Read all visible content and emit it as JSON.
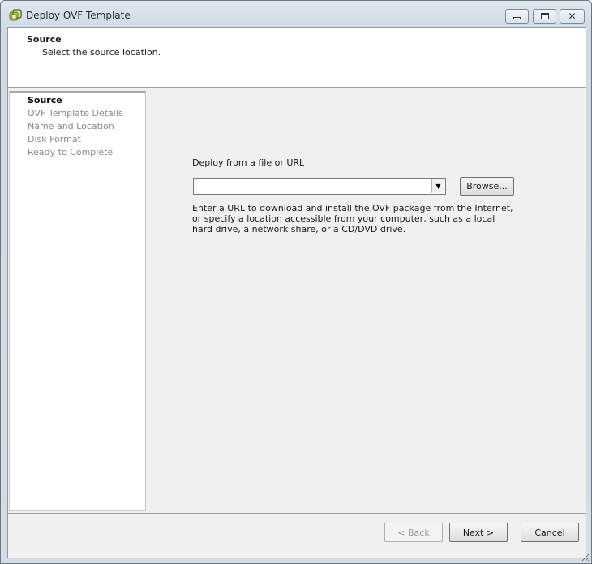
{
  "window": {
    "title": "Deploy OVF Template",
    "icon": "vmware-ovf-icon",
    "controls": [
      "minimize",
      "maximize",
      "close"
    ]
  },
  "header": {
    "title": "Source",
    "subtitle": "Select the source location."
  },
  "steps": [
    {
      "label": "Source",
      "active": true
    },
    {
      "label": "OVF Template Details",
      "active": false
    },
    {
      "label": "Name and Location",
      "active": false
    },
    {
      "label": "Disk Format",
      "active": false
    },
    {
      "label": "Ready to Complete",
      "active": false
    }
  ],
  "source": {
    "label": "Deploy from a file or URL",
    "value": "",
    "browse_label": "Browse...",
    "hint": "Enter a URL to download and install the OVF package from the Internet, or specify a location accessible from your computer, such as a local hard drive, a network share, or a CD/DVD drive."
  },
  "footer": {
    "back_label": "< Back",
    "next_label": "Next >",
    "cancel_label": "Cancel"
  },
  "colors": {
    "active_step": "#000000",
    "inactive_step": "#8a8a8a",
    "titlebar": "#d4dde6"
  }
}
